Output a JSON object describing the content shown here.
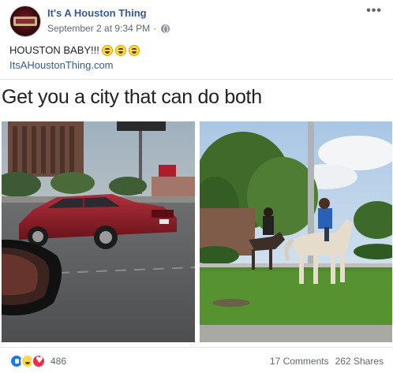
{
  "post": {
    "page_name": "It's A Houston Thing",
    "timestamp": "September 2 at 9:34 PM",
    "separator": "·",
    "caption": "HOUSTON BABY!!!",
    "caption_emojis": [
      "laughing-emoji",
      "laughing-emoji",
      "laughing-emoji"
    ],
    "link": "ItsAHoustonThing.com",
    "more_icon": "more-horizontal-icon",
    "privacy_icon": "globe-icon"
  },
  "meme": {
    "title": "Get you a city that can do both"
  },
  "footer": {
    "reaction_icons": [
      "like-icon",
      "haha-icon",
      "love-icon"
    ],
    "reaction_count": "486",
    "comments": "17 Comments",
    "shares": "262 Shares"
  },
  "colors": {
    "link_blue": "#385898",
    "meta_gray": "#616770",
    "car_red": "#8e1b25",
    "grass_green": "#4f8a2c"
  }
}
